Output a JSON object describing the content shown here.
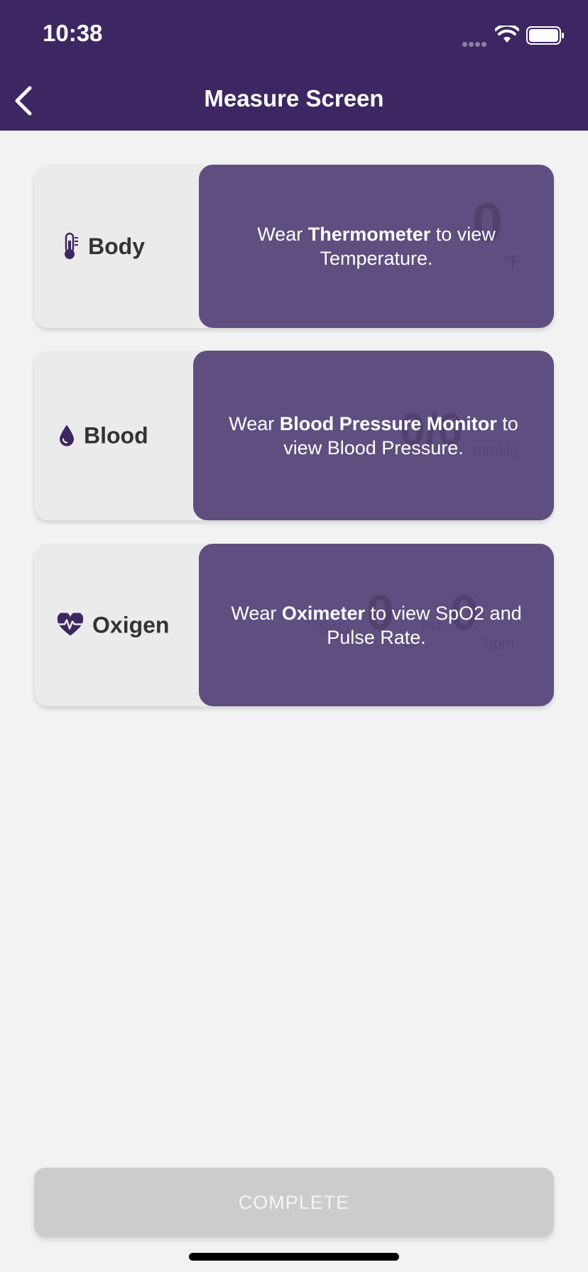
{
  "status": {
    "time": "10:38"
  },
  "nav": {
    "title": "Measure Screen"
  },
  "cards": [
    {
      "label": "Body",
      "icon": "thermometer-icon",
      "msg_pre": "Wear ",
      "msg_bold": "Thermometer",
      "msg_post": " to view Temperature.",
      "ghost_value": "0",
      "ghost_unit": "°F"
    },
    {
      "label": "Blood",
      "icon": "blood-drop-icon",
      "msg_pre": "Wear ",
      "msg_bold": "Blood Pressure Monitor",
      "msg_post": " to view Blood Pressure.",
      "ghost_value": "0/0",
      "ghost_unit": "mmHg"
    },
    {
      "label": "Oxigen",
      "icon": "heart-pulse-icon",
      "msg_pre": "Wear ",
      "msg_bold": "Oximeter",
      "msg_post": " to view SpO2 and Pulse Rate.",
      "ghost_spo2_label": "SpO",
      "ghost_spo2_value": "0",
      "ghost_spo2_unit": "%",
      "ghost_pr_label": "PR",
      "ghost_pr_value": "0",
      "ghost_pr_unit": "bpm"
    }
  ],
  "complete_button": {
    "label": "COMPLETE"
  },
  "colors": {
    "header": "#3c2762",
    "panel": "#5f4e80",
    "accent": "#3c2762"
  }
}
